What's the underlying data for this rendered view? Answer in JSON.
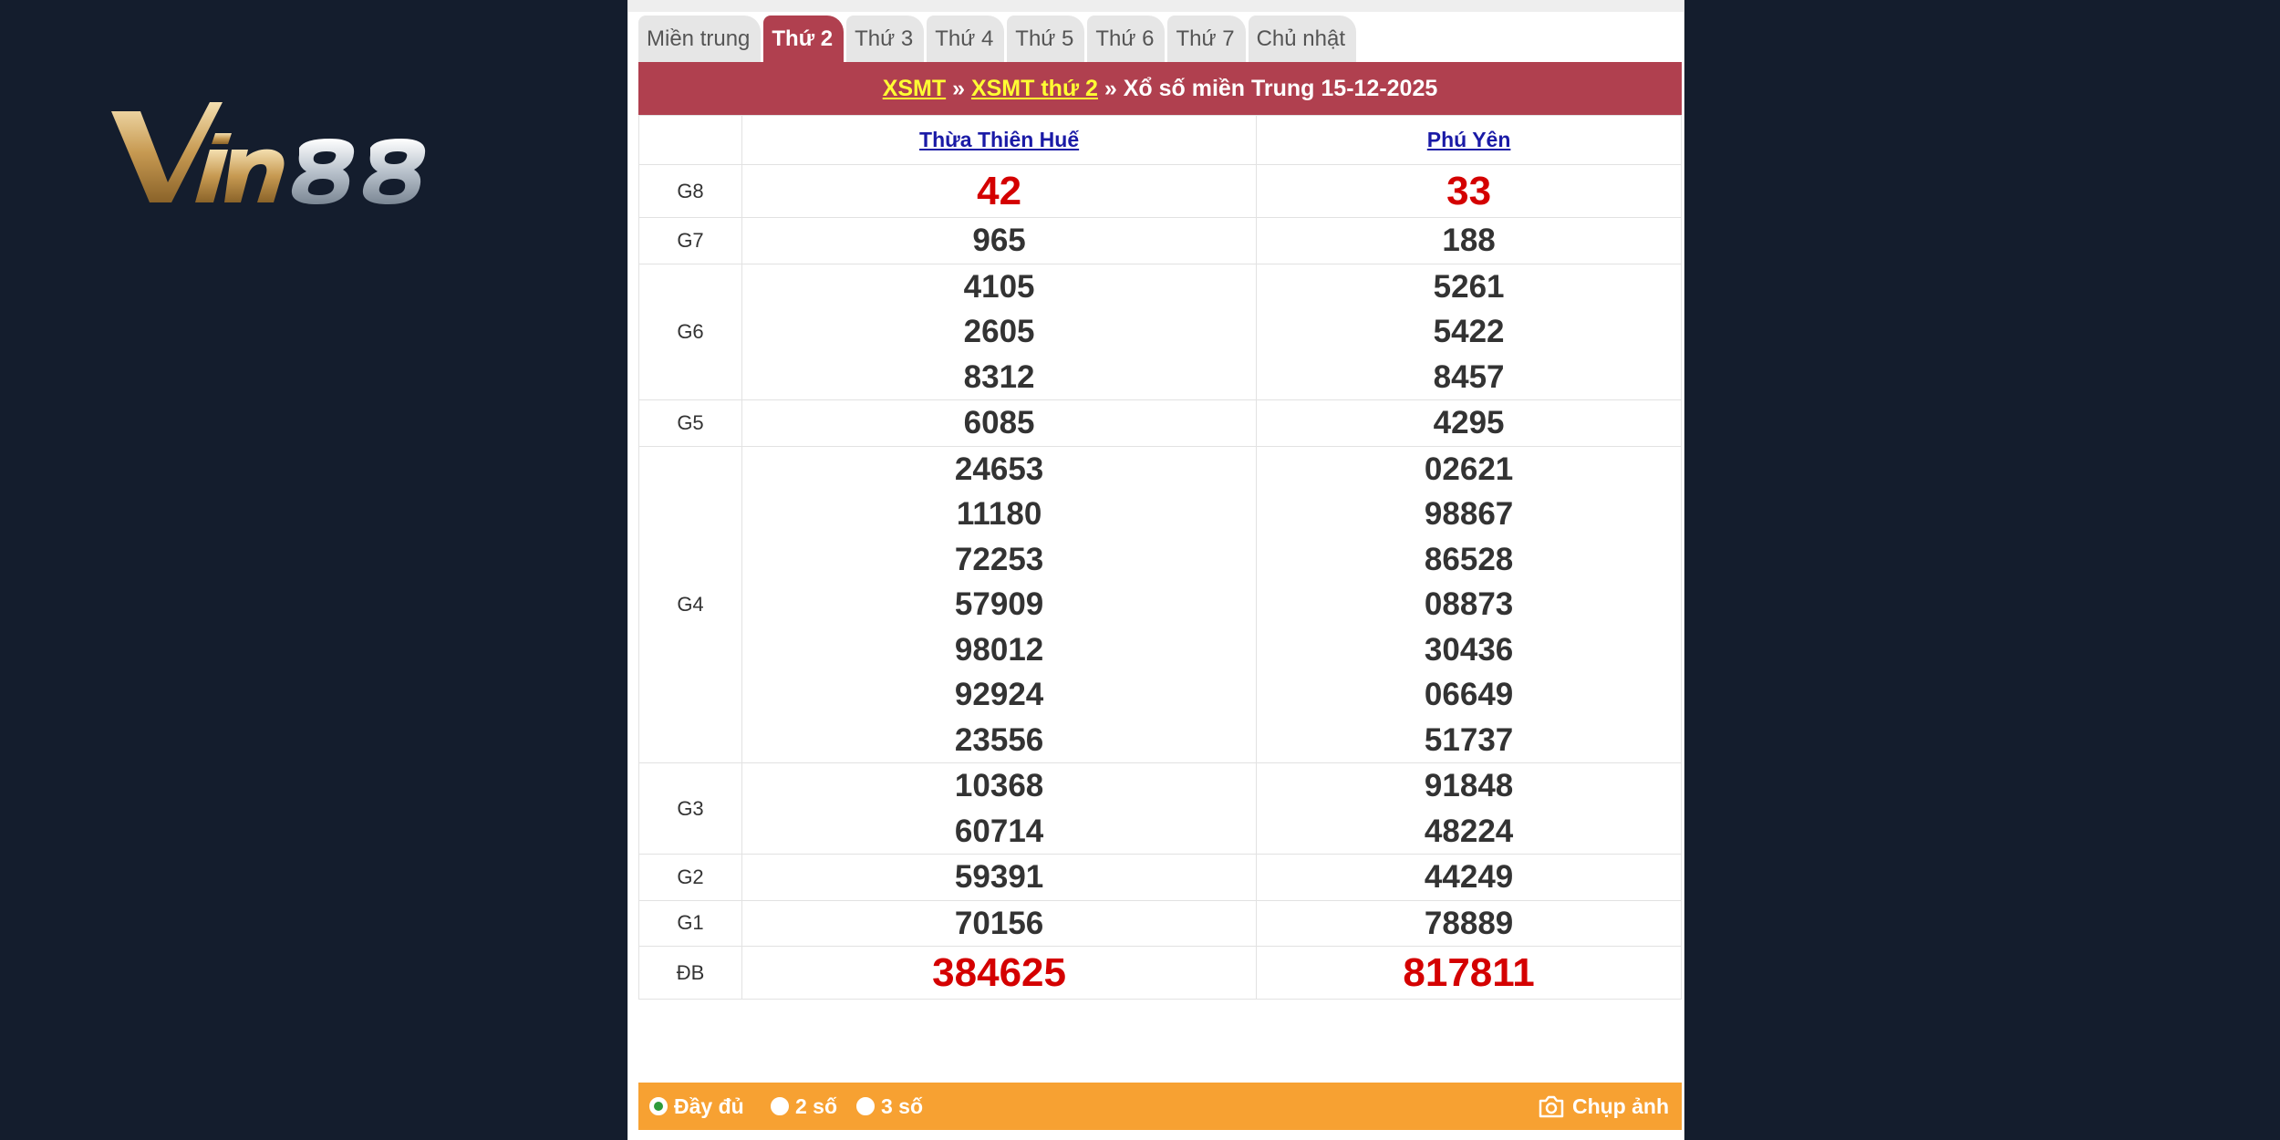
{
  "logo": {
    "text": "Vin88"
  },
  "tabs": [
    {
      "label": "Miền trung",
      "active": false
    },
    {
      "label": "Thứ 2",
      "active": true
    },
    {
      "label": "Thứ 3",
      "active": false
    },
    {
      "label": "Thứ 4",
      "active": false
    },
    {
      "label": "Thứ 5",
      "active": false
    },
    {
      "label": "Thứ 6",
      "active": false
    },
    {
      "label": "Thứ 7",
      "active": false
    },
    {
      "label": "Chủ nhật",
      "active": false
    }
  ],
  "header": {
    "link1": "XSMT",
    "sep1": " » ",
    "link2": "XSMT thứ 2",
    "sep2": " » ",
    "title": "Xổ số miền Trung 15-12-2025"
  },
  "provinces": [
    "Thừa Thiên Huế",
    "Phú Yên"
  ],
  "prizes": [
    {
      "label": "G8",
      "highlight": true,
      "values": [
        [
          "42"
        ],
        [
          "33"
        ]
      ]
    },
    {
      "label": "G7",
      "values": [
        [
          "965"
        ],
        [
          "188"
        ]
      ]
    },
    {
      "label": "G6",
      "values": [
        [
          "4105",
          "2605",
          "8312"
        ],
        [
          "5261",
          "5422",
          "8457"
        ]
      ]
    },
    {
      "label": "G5",
      "values": [
        [
          "6085"
        ],
        [
          "4295"
        ]
      ]
    },
    {
      "label": "G4",
      "values": [
        [
          "24653",
          "11180",
          "72253",
          "57909",
          "98012",
          "92924",
          "23556"
        ],
        [
          "02621",
          "98867",
          "86528",
          "08873",
          "30436",
          "06649",
          "51737"
        ]
      ]
    },
    {
      "label": "G3",
      "values": [
        [
          "10368",
          "60714"
        ],
        [
          "91848",
          "48224"
        ]
      ]
    },
    {
      "label": "G2",
      "values": [
        [
          "59391"
        ],
        [
          "44249"
        ]
      ]
    },
    {
      "label": "G1",
      "values": [
        [
          "70156"
        ],
        [
          "78889"
        ]
      ]
    },
    {
      "label": "ĐB",
      "highlight": true,
      "values": [
        [
          "384625"
        ],
        [
          "817811"
        ]
      ]
    }
  ],
  "footer": {
    "options": [
      {
        "label": "Đầy đủ",
        "checked": true
      },
      {
        "label": "2 số",
        "checked": false
      },
      {
        "label": "3 số",
        "checked": false
      }
    ],
    "capture_label": "Chụp ảnh"
  },
  "colors": {
    "background": "#141d2d",
    "accent": "#b0404f",
    "footer": "#f7a132",
    "highlight_number": "#d40000",
    "link": "#1a1aa6",
    "header_link": "#ffff33"
  }
}
